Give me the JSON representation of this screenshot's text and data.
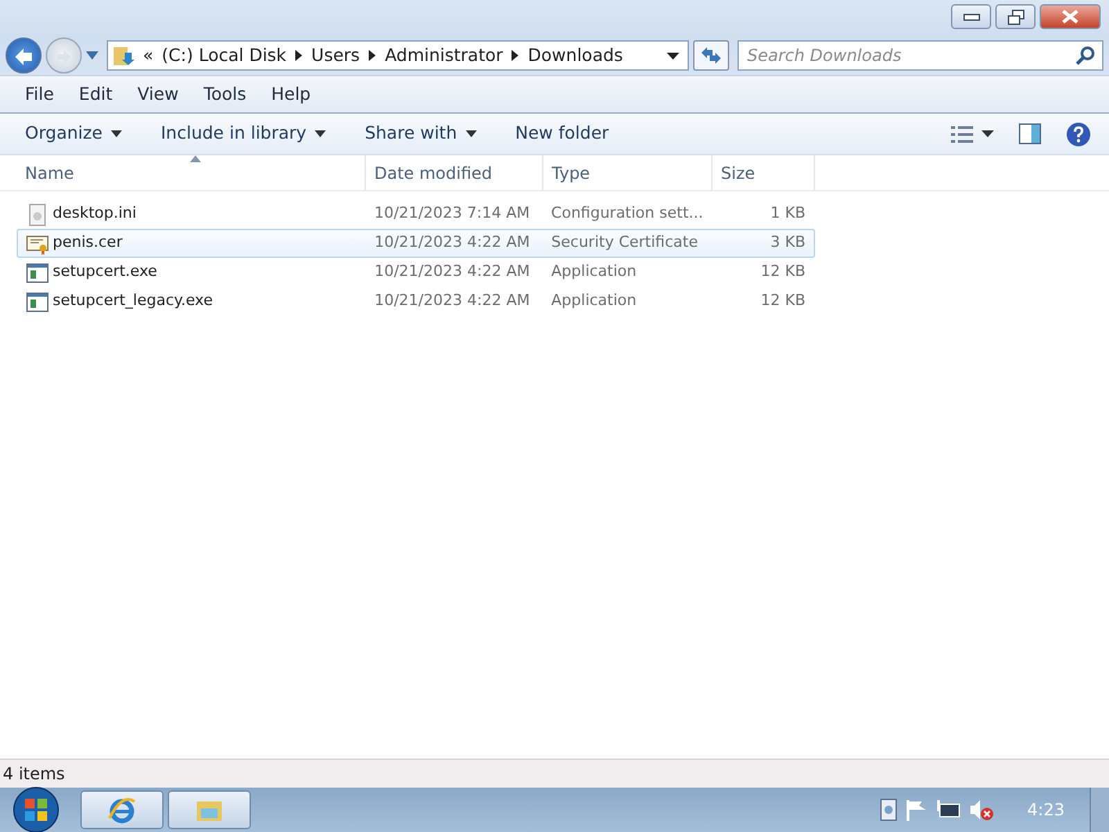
{
  "address": {
    "crumbs": [
      "(C:) Local Disk",
      "Users",
      "Administrator",
      "Downloads"
    ],
    "overflow": "«"
  },
  "search": {
    "placeholder": "Search Downloads"
  },
  "menu": [
    "File",
    "Edit",
    "View",
    "Tools",
    "Help"
  ],
  "toolbar": [
    "Organize",
    "Include in library",
    "Share with",
    "New folder"
  ],
  "columns": [
    "Name",
    "Date modified",
    "Type",
    "Size"
  ],
  "files": [
    {
      "name": "desktop.ini",
      "date": "10/21/2023 7:14 AM",
      "type": "Configuration sett...",
      "size": "1 KB",
      "kind": "ini",
      "selected": false
    },
    {
      "name": "penis.cer",
      "date": "10/21/2023 4:22 AM",
      "type": "Security Certificate",
      "size": "3 KB",
      "kind": "cert",
      "selected": true
    },
    {
      "name": "setupcert.exe",
      "date": "10/21/2023 4:22 AM",
      "type": "Application",
      "size": "12 KB",
      "kind": "exe",
      "selected": false
    },
    {
      "name": "setupcert_legacy.exe",
      "date": "10/21/2023 4:22 AM",
      "type": "Application",
      "size": "12 KB",
      "kind": "exe",
      "selected": false
    }
  ],
  "status_bar": "4 items",
  "clock": "4:23"
}
